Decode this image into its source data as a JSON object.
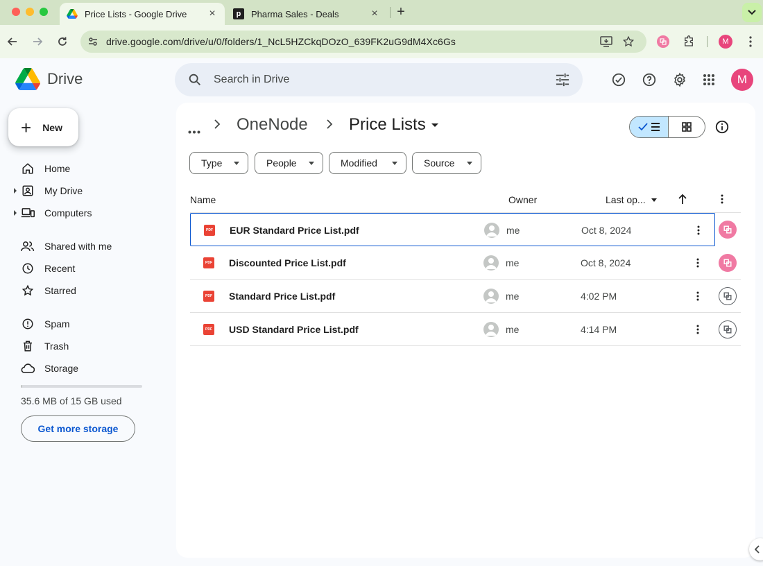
{
  "browser": {
    "tabs": [
      {
        "title": "Price Lists - Google Drive",
        "active": true
      },
      {
        "title": "Pharma Sales - Deals",
        "active": false
      }
    ],
    "url": "drive.google.com/drive/u/0/folders/1_NcL5HZCkqDOzO_639FK2uG9dM4Xc6Gs",
    "profile_initial": "M"
  },
  "app": {
    "name": "Drive",
    "search_placeholder": "Search in Drive",
    "account_initial": "M"
  },
  "sidebar": {
    "new_label": "New",
    "items": [
      {
        "label": "Home",
        "icon": "home-icon"
      },
      {
        "label": "My Drive",
        "icon": "my-drive-icon"
      },
      {
        "label": "Computers",
        "icon": "computers-icon"
      },
      {
        "label": "Shared with me",
        "icon": "shared-icon"
      },
      {
        "label": "Recent",
        "icon": "clock-icon"
      },
      {
        "label": "Starred",
        "icon": "star-icon"
      },
      {
        "label": "Spam",
        "icon": "spam-icon"
      },
      {
        "label": "Trash",
        "icon": "trash-icon"
      },
      {
        "label": "Storage",
        "icon": "cloud-icon"
      }
    ],
    "storage_used_fraction": 0.0024,
    "storage_text": "35.6 MB of 15 GB used",
    "storage_button": "Get more storage"
  },
  "breadcrumb": {
    "parent": "OneNode",
    "current": "Price Lists"
  },
  "filters": [
    "Type",
    "People",
    "Modified",
    "Source"
  ],
  "columns": {
    "name": "Name",
    "owner": "Owner",
    "last_opened": "Last op..."
  },
  "files": [
    {
      "name": "EUR Standard Price List.pdf",
      "owner": "me",
      "date": "Oct 8, 2024"
    },
    {
      "name": "Discounted Price List.pdf",
      "owner": "me",
      "date": "Oct 8, 2024"
    },
    {
      "name": "Standard Price List.pdf",
      "owner": "me",
      "date": "4:02 PM"
    },
    {
      "name": "USD Standard Price List.pdf",
      "owner": "me",
      "date": "4:14 PM"
    }
  ],
  "colors": {
    "accent": "#0b57d0",
    "selected_view": "#c2e7ff",
    "avatar": "#e8457c",
    "pdf": "#ea4335"
  }
}
